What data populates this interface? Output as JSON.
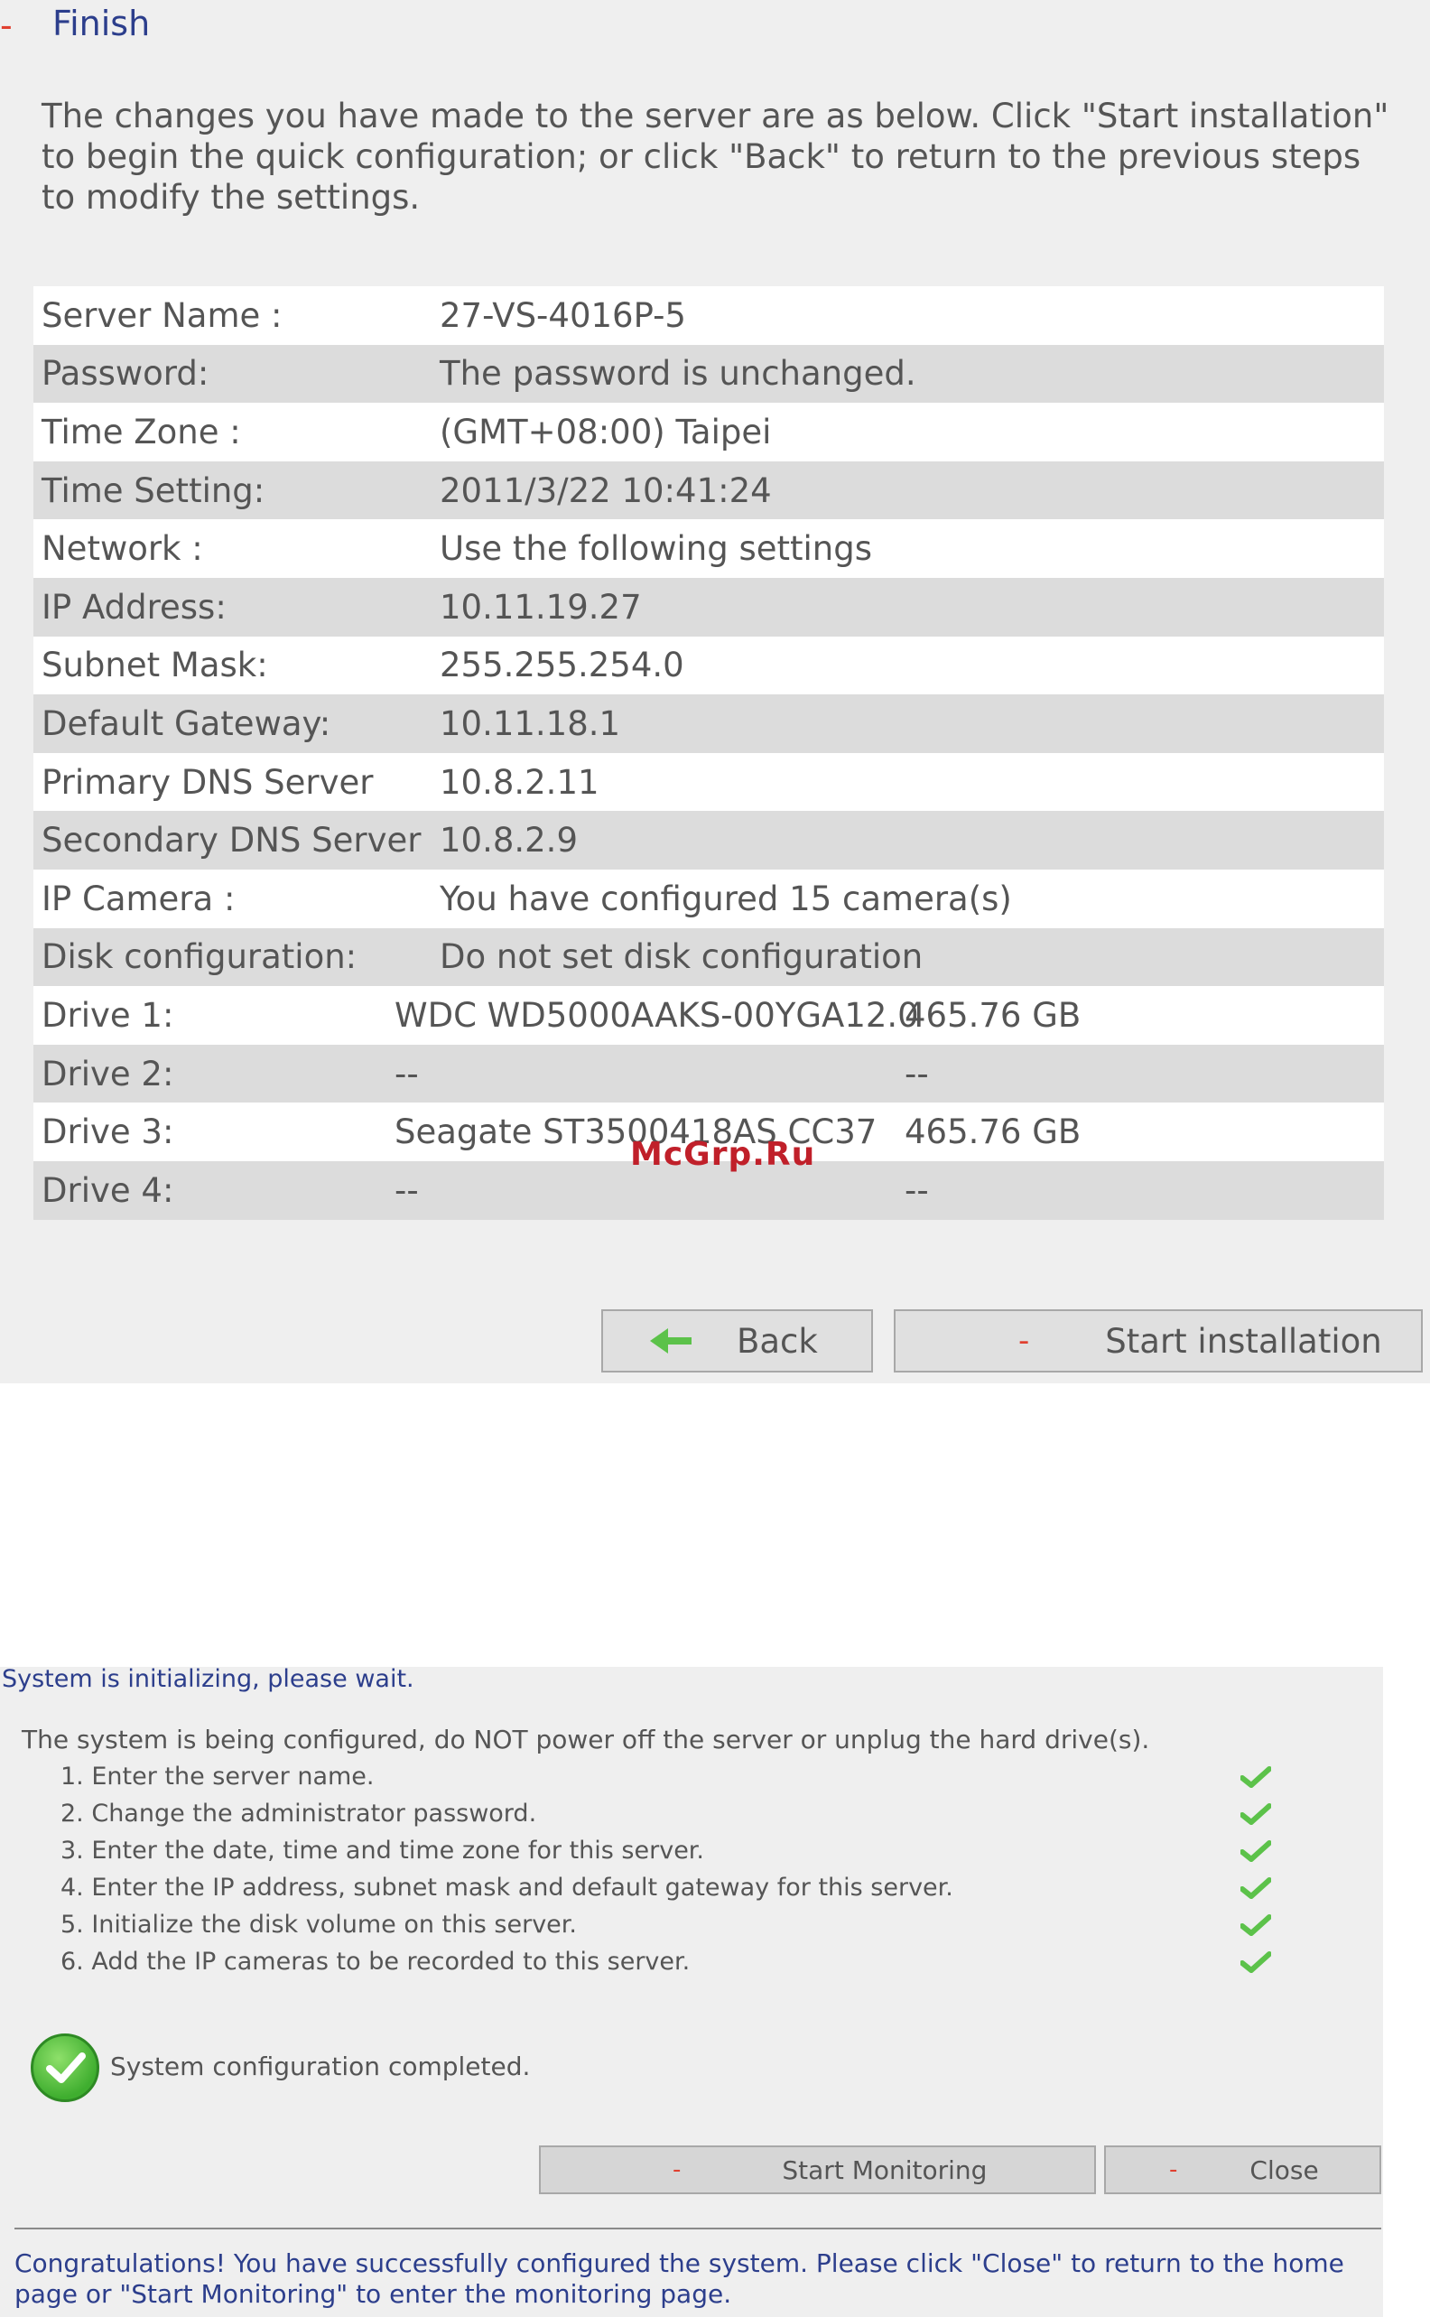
{
  "finish": {
    "dash": "-",
    "title": "Finish",
    "intro": "The changes you have made to the server are as below. Click \"Start installation\" to begin the quick configuration; or click \"Back\" to return to the previous steps to modify the settings."
  },
  "summary": [
    {
      "label": "Server Name :",
      "value": "27-VS-4016P-5"
    },
    {
      "label": "Password:",
      "value": "The password is unchanged."
    },
    {
      "label": "Time Zone :",
      "value": "(GMT+08:00) Taipei"
    },
    {
      "label": "Time Setting:",
      "value": "2011/3/22 10:41:24"
    },
    {
      "label": "Network :",
      "value": "Use the following settings"
    },
    {
      "label": "IP Address:",
      "value": "10.11.19.27"
    },
    {
      "label": "Subnet Mask:",
      "value": "255.255.254.0"
    },
    {
      "label": "Default Gateway:",
      "value": "10.11.18.1"
    },
    {
      "label": "Primary DNS Server",
      "value": "10.8.2.11"
    },
    {
      "label": "Secondary DNS Server",
      "value": "10.8.2.9"
    },
    {
      "label": "IP Camera :",
      "value": "You have configured 15 camera(s)"
    },
    {
      "label": "Disk configuration:",
      "value": "Do not set disk configuration"
    }
  ],
  "drives": [
    {
      "label": "Drive 1:",
      "model": "WDC WD5000AAKS-00YGA12.0",
      "size": "465.76 GB"
    },
    {
      "label": "Drive 2:",
      "model": "--",
      "size": "--"
    },
    {
      "label": "Drive 3:",
      "model": "Seagate ST3500418AS CC37",
      "size": "465.76 GB"
    },
    {
      "label": "Drive 4:",
      "model": "--",
      "size": "--"
    }
  ],
  "buttons": {
    "back": "Back",
    "start_installation": "Start installation",
    "dash": "-"
  },
  "watermark": "McGrp.Ru",
  "init": {
    "title": "System is initializing, please wait.",
    "note": "The system is being configured, do NOT power off the server or unplug the hard drive(s).",
    "steps": [
      "1. Enter the server name.",
      "2. Change the administrator password.",
      "3. Enter the date, time and time zone for this server.",
      "4. Enter the IP address, subnet mask and default gateway for this server.",
      "5. Initialize the disk volume on this server.",
      "6. Add the IP cameras to be recorded to this server."
    ],
    "complete": "System configuration completed.",
    "start_monitoring": "Start Monitoring",
    "close": "Close",
    "congrats": "Congratulations! You have successfully configured the system. Please click \"Close\" to return to the home page or \"Start Monitoring\" to enter the monitoring page."
  },
  "colors": {
    "title_blue": "#2c3e8c",
    "check_green": "#5cc24a",
    "dash_red": "#e04030"
  },
  "icons": {
    "back": "arrow-left-icon",
    "step_done": "checkmark-icon",
    "complete": "check-circle-icon"
  }
}
